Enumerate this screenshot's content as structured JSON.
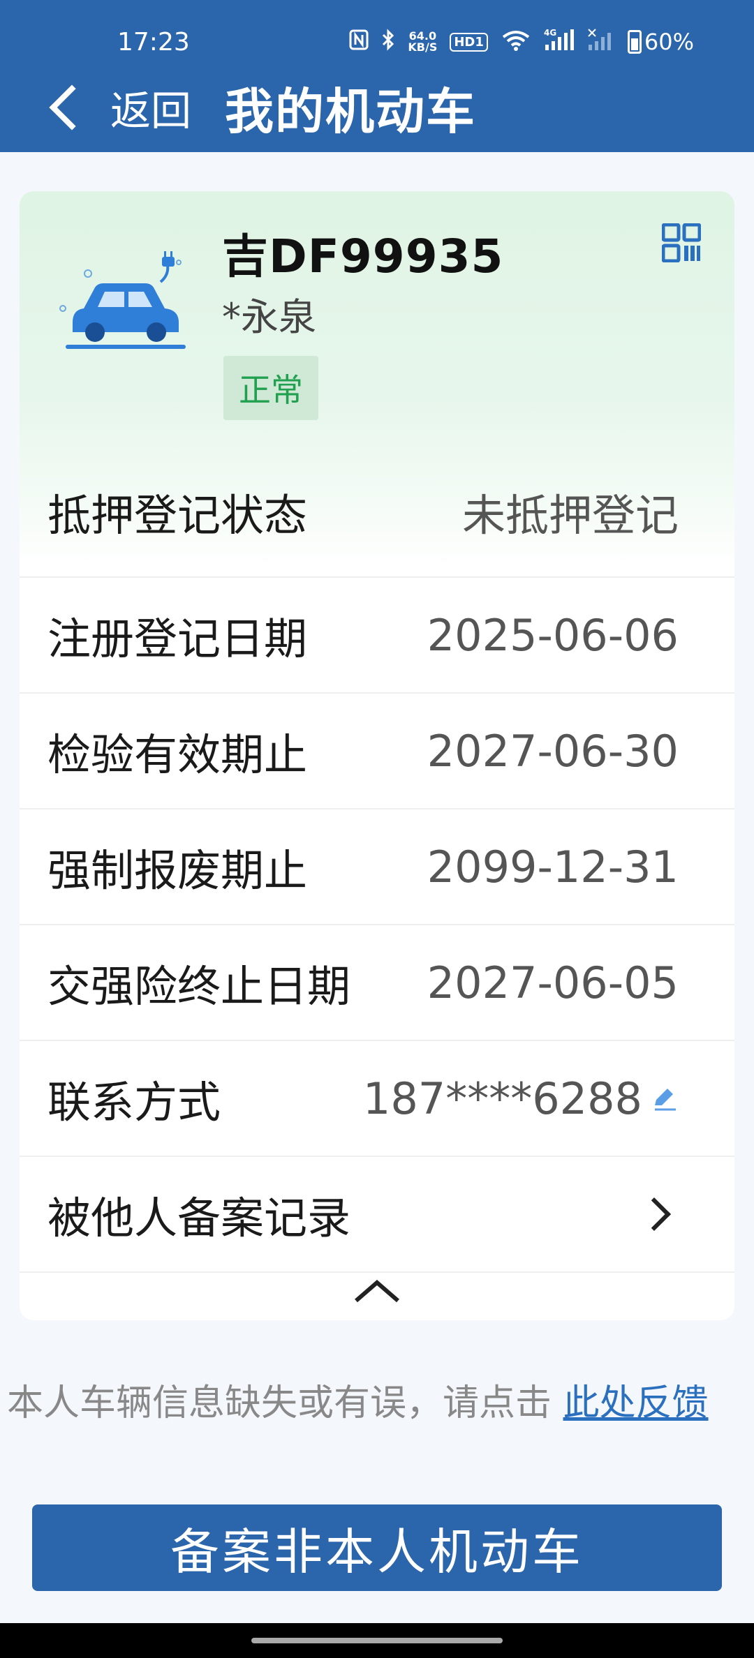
{
  "status_bar": {
    "time": "17:23",
    "net_speed_value": "64.0",
    "net_speed_unit": "KB/S",
    "hd_badge": "HD1",
    "signal_4g": "4G",
    "battery": "60%"
  },
  "nav": {
    "back_label": "返回",
    "title": "我的机动车"
  },
  "vehicle": {
    "plate": "吉DF99935",
    "owner": "*永泉",
    "status": "正常"
  },
  "details": [
    {
      "label": "抵押登记状态",
      "value": "未抵押登记"
    },
    {
      "label": "注册登记日期",
      "value": "2025-06-06"
    },
    {
      "label": "检验有效期止",
      "value": "2027-06-30"
    },
    {
      "label": "强制报废期止",
      "value": "2099-12-31"
    },
    {
      "label": "交强险终止日期",
      "value": "2027-06-05"
    },
    {
      "label": "联系方式",
      "value": "187****6288"
    },
    {
      "label": "被他人备案记录",
      "value": ""
    }
  ],
  "feedback": {
    "text": "本人车辆信息缺失或有误，请点击 ",
    "link": "此处反馈"
  },
  "primary_button": {
    "label": "备案非本人机动车"
  },
  "colors": {
    "header": "#2b65ab",
    "status_green": "#21a050",
    "link_blue": "#2b6fbf"
  }
}
